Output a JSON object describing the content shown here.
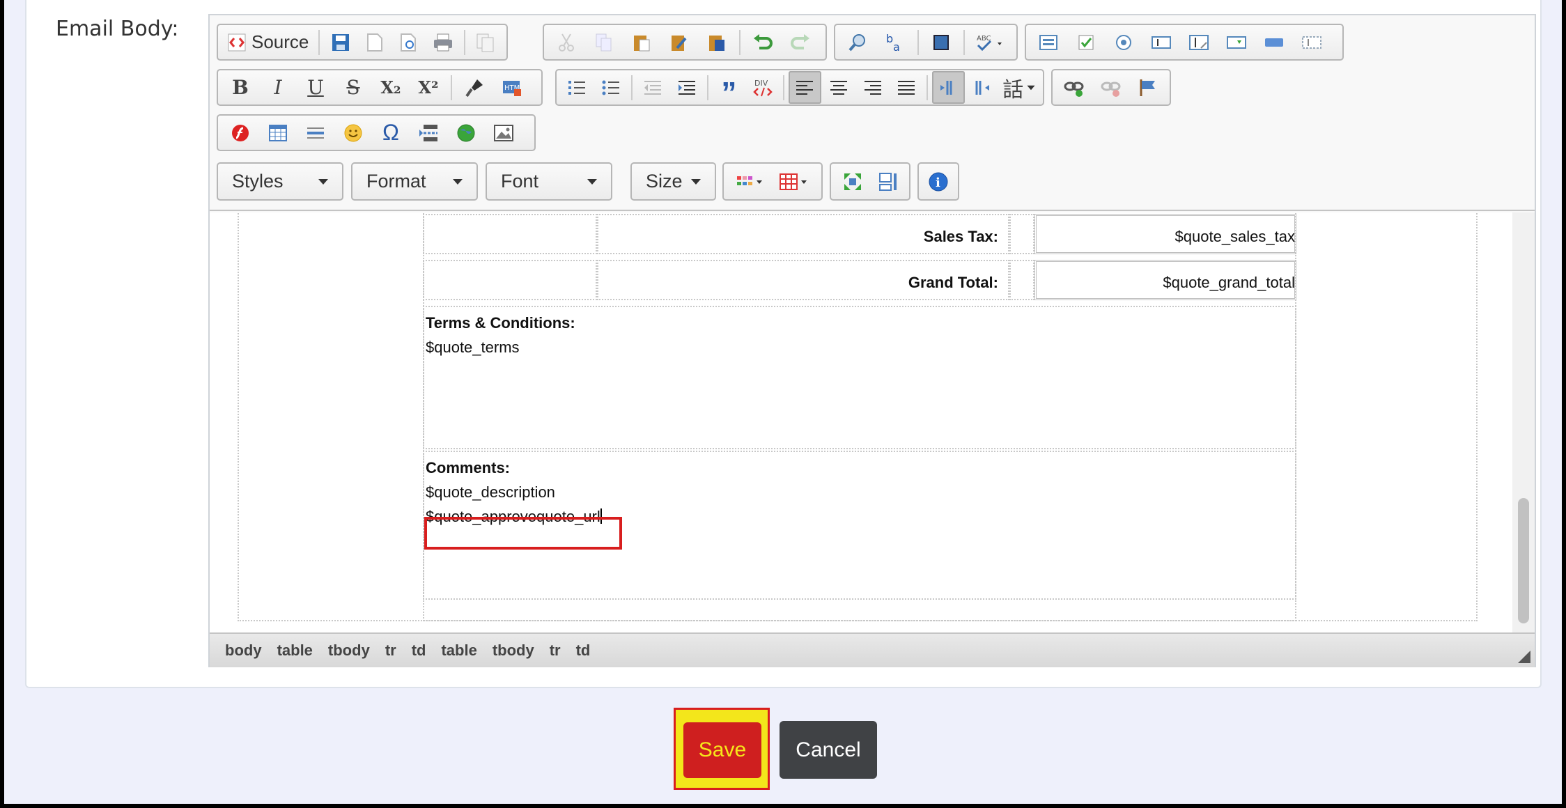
{
  "form": {
    "email_body_label": "Email Body:"
  },
  "toolbar": {
    "source_label": "Source",
    "combos": {
      "styles": "Styles",
      "format": "Format",
      "font": "Font",
      "size": "Size"
    },
    "text_icons": {
      "bold": "B",
      "italic": "I",
      "underline": "U",
      "strike": "S",
      "subscript": "X₂",
      "superscript": "X²",
      "omega": "Ω",
      "blockquote": "”",
      "language": "話",
      "info": "i"
    }
  },
  "content": {
    "sales_tax_label": "Sales Tax:",
    "sales_tax_value": "$quote_sales_tax",
    "grand_total_label": "Grand Total:",
    "grand_total_value": "$quote_grand_total",
    "terms_label": "Terms & Conditions:",
    "terms_value": "$quote_terms",
    "comments_label": "Comments:",
    "comments_value": "$quote_description",
    "approve_url": "$quote_approvequote_url"
  },
  "path_bar": {
    "items": [
      "body",
      "table",
      "tbody",
      "tr",
      "td",
      "table",
      "tbody",
      "tr",
      "td"
    ]
  },
  "actions": {
    "save_label": "Save",
    "cancel_label": "Cancel"
  },
  "colors": {
    "save_bg": "#cf1f1f",
    "save_text": "#f6e61a",
    "highlight": "#d81e1e",
    "cancel_bg": "#404245"
  }
}
